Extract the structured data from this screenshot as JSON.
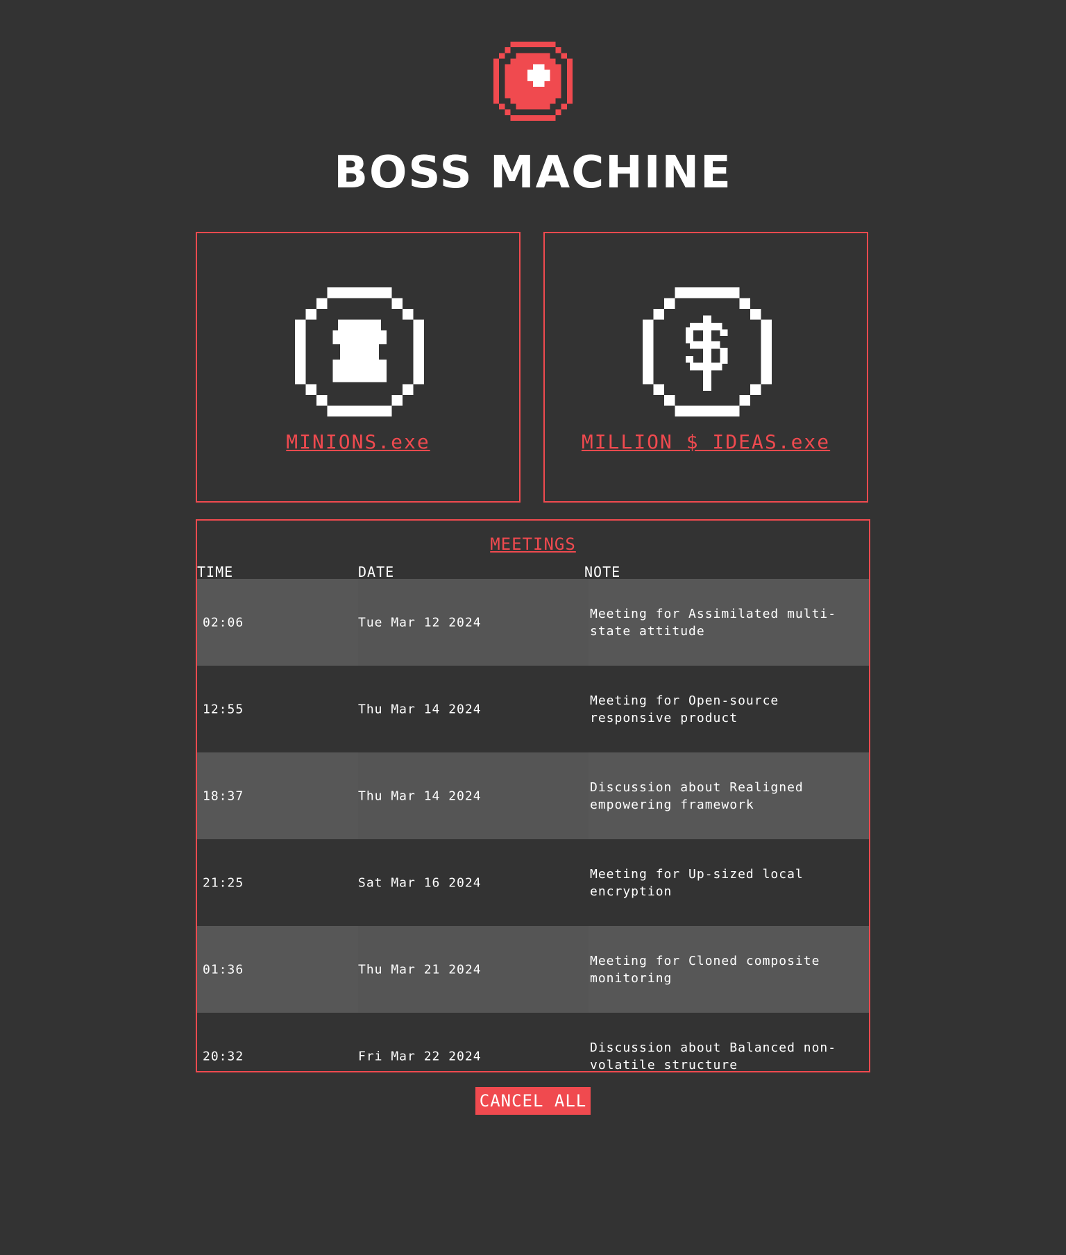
{
  "header": {
    "logo_icon": "boss-machine-logo-icon",
    "title": "BOSS MACHINE"
  },
  "cards": [
    {
      "icon": "minion-icon",
      "label": "MINIONS.exe"
    },
    {
      "icon": "dollar-coin-icon",
      "label": "MILLION $ IDEAS.exe"
    }
  ],
  "meetings": {
    "title": "MEETINGS",
    "columns": [
      "TIME",
      "DATE",
      "NOTE"
    ],
    "rows": [
      {
        "time": "02:06",
        "date": "Tue Mar 12 2024",
        "note": "Meeting for Assimilated multi-state attitude"
      },
      {
        "time": "12:55",
        "date": "Thu Mar 14 2024",
        "note": "Meeting for Open-source responsive product"
      },
      {
        "time": "18:37",
        "date": "Thu Mar 14 2024",
        "note": "Discussion about Realigned empowering framework"
      },
      {
        "time": "21:25",
        "date": "Sat Mar 16 2024",
        "note": "Meeting for Up-sized local encryption"
      },
      {
        "time": "01:36",
        "date": "Thu Mar 21 2024",
        "note": "Meeting for Cloned composite monitoring"
      },
      {
        "time": "20:32",
        "date": "Fri Mar 22 2024",
        "note": "Discussion about Balanced non-volatile structure"
      }
    ],
    "cancel_label": "CANCEL ALL"
  },
  "colors": {
    "background": "#333333",
    "accent": "#f04a4f",
    "row_alt": "#575757",
    "text": "#ffffff"
  }
}
